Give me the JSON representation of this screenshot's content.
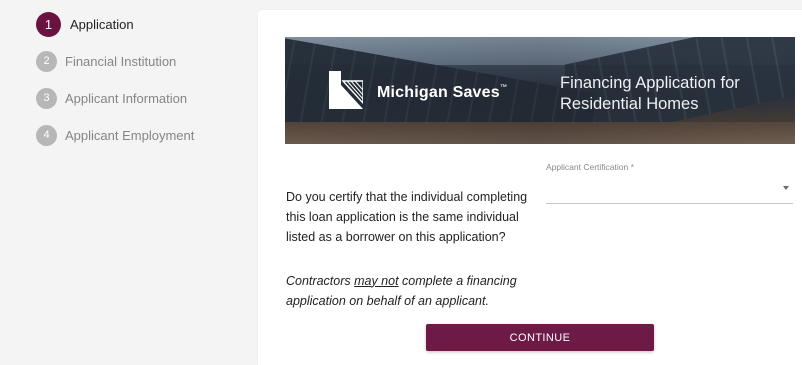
{
  "stepper": {
    "steps": [
      {
        "number": "1",
        "label": "Application",
        "active": true
      },
      {
        "number": "2",
        "label": "Financial Institution",
        "active": false
      },
      {
        "number": "3",
        "label": "Applicant Information",
        "active": false
      },
      {
        "number": "4",
        "label": "Applicant Employment",
        "active": false
      }
    ]
  },
  "banner": {
    "brand_name": "Michigan Saves",
    "brand_trademark": "™",
    "title": "Financing Application for Residential Homes"
  },
  "question": {
    "text": "Do you certify that the individual completing this loan application is the same individual listed as a borrower on this application?",
    "note_before": "Contractors ",
    "note_emphasis": "may not",
    "note_after": " complete a financing application on behalf of an applicant."
  },
  "certification_field": {
    "label": "Applicant Certification *",
    "value": ""
  },
  "actions": {
    "continue_label": "CONTINUE"
  },
  "colors": {
    "accent": "#6d1a47",
    "inactive_step": "#b7b7b7",
    "page_background": "#f4f4f4"
  },
  "icons": {
    "dropdown": "chevron-down-icon",
    "brand_logo": "michigan-saves-logo"
  }
}
